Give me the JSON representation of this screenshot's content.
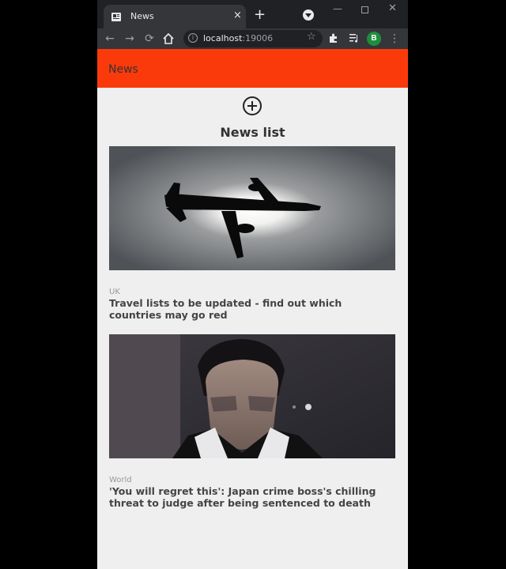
{
  "browser": {
    "tab_title": "News",
    "tab_close": "×",
    "new_tab": "+",
    "url_host": "localhost",
    "url_port": ":19006",
    "profile_initial": "B"
  },
  "app": {
    "header_title": "News",
    "list_title": "News list"
  },
  "articles": [
    {
      "category": "UK",
      "title": "Travel lists to be updated - find out which countries may go red",
      "image": "airplane-silhouette-photo"
    },
    {
      "category": "World",
      "title": "'You will regret this': Japan crime boss's chilling threat to judge after being sentenced to death",
      "image": "man-portrait-photo"
    }
  ],
  "colors": {
    "appbar": "#fb3a0c",
    "page_bg": "#efefef",
    "chrome_dark": "#202124",
    "chrome_toolbar": "#35363a"
  }
}
